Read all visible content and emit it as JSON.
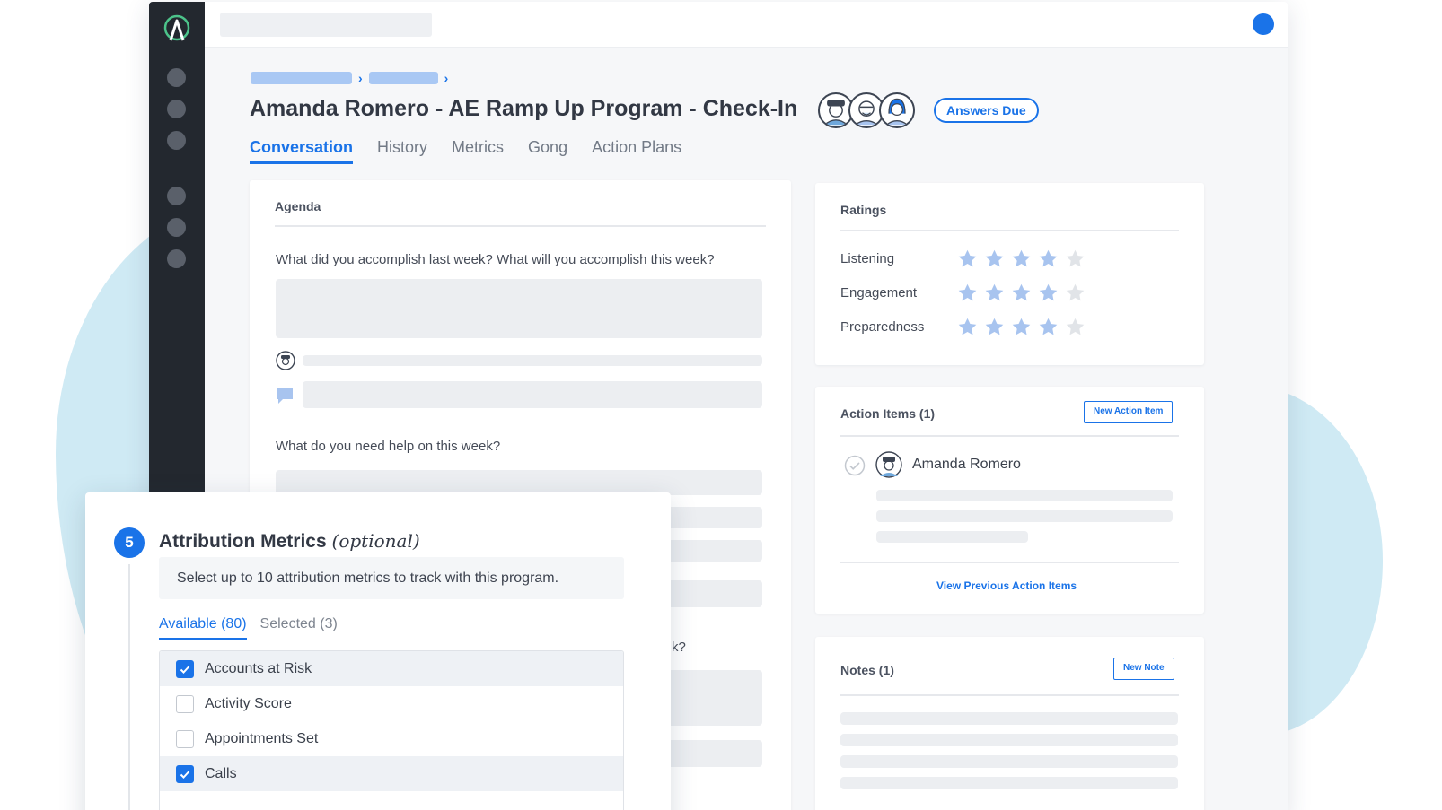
{
  "page": {
    "title": "Amanda Romero - AE Ramp Up Program - Check-In",
    "status": "Answers Due",
    "tabs": [
      "Conversation",
      "History",
      "Metrics",
      "Gong",
      "Action Plans"
    ],
    "active_tab": "Conversation"
  },
  "agenda": {
    "title": "Agenda",
    "questions": [
      "What did you accomplish last week? What will you accomplish this week?",
      "What do you need help on this week?",
      "k?"
    ]
  },
  "ratings": {
    "title": "Ratings",
    "max": 5,
    "items": [
      {
        "label": "Listening",
        "value": 4
      },
      {
        "label": "Engagement",
        "value": 4
      },
      {
        "label": "Preparedness",
        "value": 4
      }
    ]
  },
  "action_items": {
    "title": "Action Items (1)",
    "new_button": "New Action Item",
    "assignee": "Amanda Romero",
    "view_previous": "View Previous Action Items"
  },
  "notes": {
    "title": "Notes (1)",
    "new_button": "New Note"
  },
  "attribution": {
    "step": "5",
    "title": "Attribution Metrics",
    "title_suffix": "(optional)",
    "hint": "Select up to 10 attribution metrics to track with this program.",
    "tabs": [
      "Available (80)",
      "Selected (3)"
    ],
    "metrics": [
      {
        "label": "Accounts at Risk",
        "checked": true
      },
      {
        "label": "Activity Score",
        "checked": false
      },
      {
        "label": "Appointments Set",
        "checked": false
      },
      {
        "label": "Calls",
        "checked": true
      }
    ]
  },
  "colors": {
    "accent": "#1a73e8",
    "sidebar": "#23282f",
    "star_on": "#a8c4ef",
    "star_off": "#e1e4e8",
    "blob": "#cfeaf4"
  }
}
